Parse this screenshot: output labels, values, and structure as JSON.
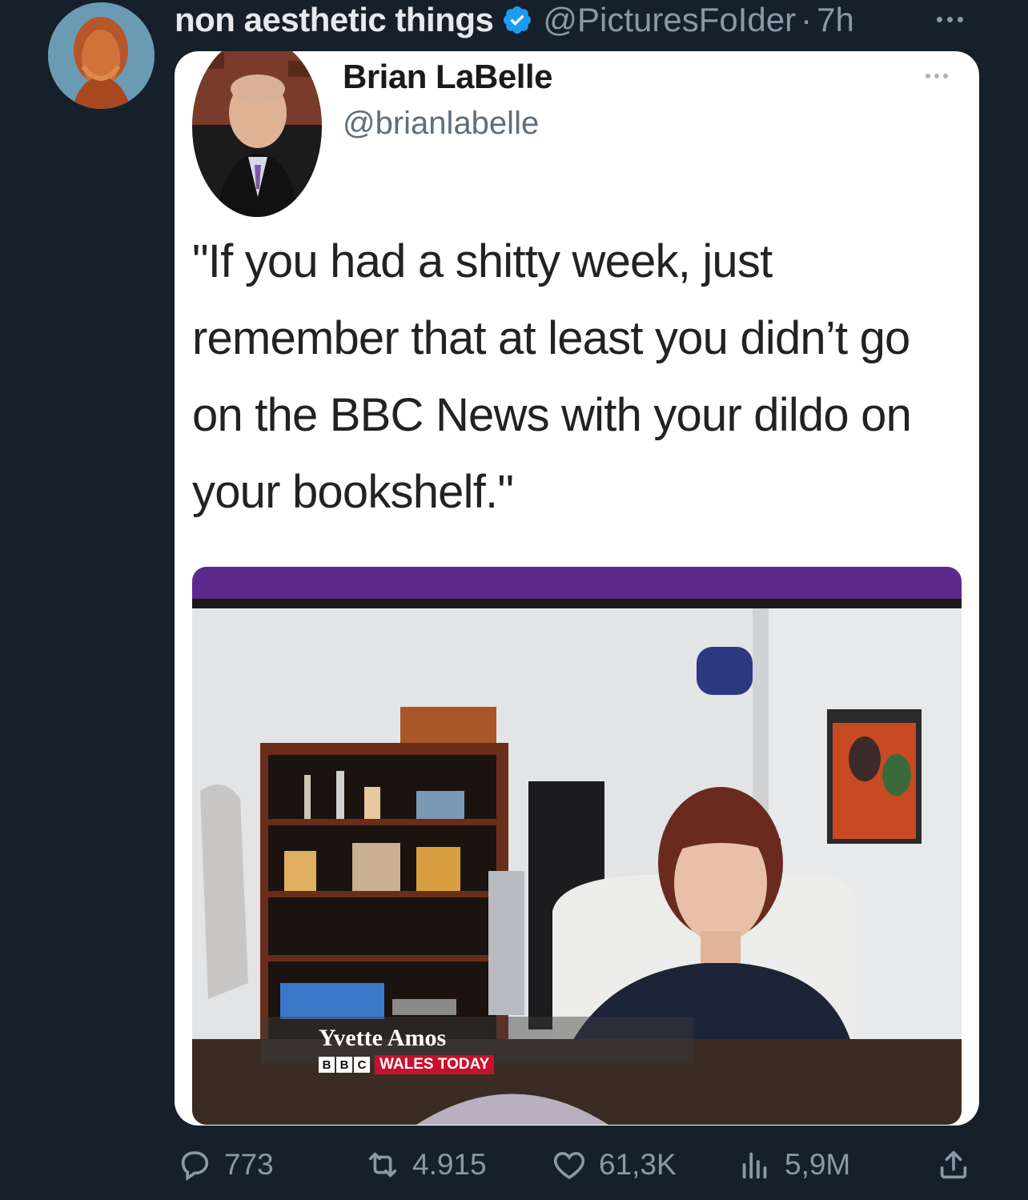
{
  "post": {
    "author_name": "non aesthetic things",
    "author_handle": "@PicturesFoIder",
    "separator": "·",
    "time": "7h"
  },
  "embedded": {
    "name": "Brian LaBelle",
    "handle": "@brianlabelle",
    "text": "\"If you had a shitty week, just remember that at least you didn’t go on the BBC News with your dildo on your bookshelf.\""
  },
  "photo": {
    "caption_name": "Yvette Amos",
    "bbc_letters": [
      "B",
      "B",
      "C"
    ],
    "program": "WALES TODAY"
  },
  "actions": {
    "replies": "773",
    "retweets": "4.915",
    "likes": "61,3K",
    "views": "5,9M"
  },
  "colors": {
    "background": "#15202b",
    "muted": "#8b98a5",
    "verified": "#1d9bf0"
  }
}
